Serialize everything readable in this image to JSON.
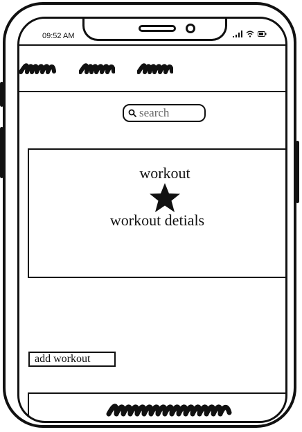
{
  "status_bar": {
    "time": "09:52 AM",
    "icons": [
      "signal-icon",
      "wifi-icon",
      "battery-icon"
    ]
  },
  "search": {
    "placeholder": "search",
    "icon": "search-icon"
  },
  "card": {
    "title": "workout",
    "icon": "star-icon",
    "details": "workout detials"
  },
  "actions": {
    "add_label": "add workout"
  },
  "colors": {
    "ink": "#111111",
    "background": "#ffffff",
    "placeholder": "#666666"
  }
}
